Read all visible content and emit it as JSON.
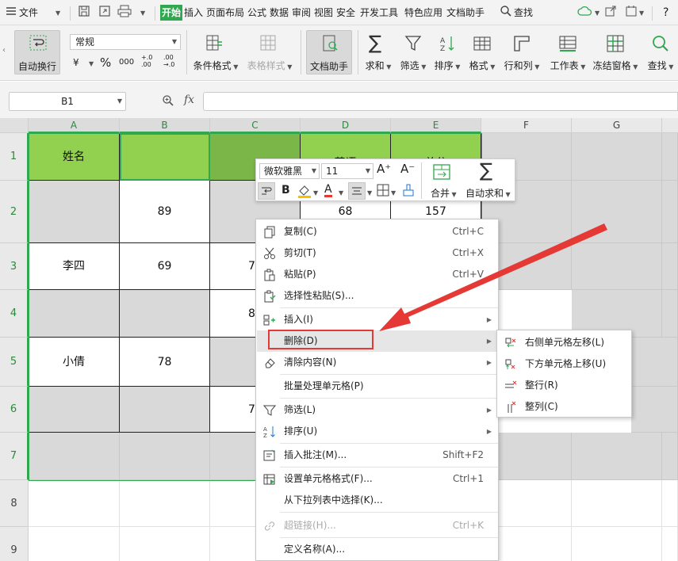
{
  "menubar": {
    "file_label": "文件",
    "tabs": [
      {
        "label": "开始",
        "active": true
      },
      {
        "label": "插入"
      },
      {
        "label": "页面布局"
      },
      {
        "label": "公式"
      },
      {
        "label": "数据"
      },
      {
        "label": "审阅"
      },
      {
        "label": "视图"
      },
      {
        "label": "安全"
      },
      {
        "label": "开发工具"
      },
      {
        "label": "特色应用"
      },
      {
        "label": "文档助手"
      }
    ],
    "search_label": "查找",
    "help_label": "?"
  },
  "ribbon": {
    "wrap_text": "自动换行",
    "number_format": "常规",
    "currency_symbol": "¥",
    "percent_symbol": "%",
    "comma_symbol": "000",
    "inc_decimal": "+.0 .00",
    "dec_decimal": ".00 →.0",
    "conditional_format": "条件格式",
    "table_style": "表格样式",
    "doc_assistant": "文档助手",
    "sum": "求和",
    "filter": "筛选",
    "sort": "排序",
    "format": "格式",
    "row_col": "行和列",
    "worksheet": "工作表",
    "freeze": "冻结窗格",
    "find": "查找"
  },
  "formula_bar": {
    "cell_ref": "B1",
    "fx": "fx",
    "formula": ""
  },
  "grid": {
    "columns": [
      "A",
      "B",
      "C",
      "D",
      "E",
      "F",
      "G"
    ],
    "rows": [
      "1",
      "2",
      "3",
      "4",
      "5",
      "6",
      "7",
      "8",
      "9"
    ],
    "cells": {
      "A1": "姓名",
      "D1": "英语",
      "E1": "总分",
      "B2": "89",
      "D2": "68",
      "E2": "157",
      "A3": "李四",
      "B3": "69",
      "C3": "7",
      "C4": "8",
      "A5": "小倩",
      "B5": "78",
      "C6": "7"
    }
  },
  "minibar": {
    "font_name": "微软雅黑",
    "font_size": "11",
    "grow_font": "A⁺",
    "shrink_font": "A⁻",
    "bold": "B",
    "merge": "合并",
    "autosum": "自动求和"
  },
  "context_menu": {
    "items": [
      {
        "label": "复制(C)",
        "shortcut": "Ctrl+C"
      },
      {
        "label": "剪切(T)",
        "shortcut": "Ctrl+X"
      },
      {
        "label": "粘贴(P)",
        "shortcut": "Ctrl+V"
      },
      {
        "label": "选择性粘贴(S)...",
        "shortcut": ""
      },
      {
        "label": "插入(I)",
        "shortcut": ""
      },
      {
        "label": "删除(D)",
        "shortcut": ""
      },
      {
        "label": "清除内容(N)",
        "shortcut": ""
      },
      {
        "label": "批量处理单元格(P)",
        "shortcut": ""
      },
      {
        "label": "筛选(L)",
        "shortcut": ""
      },
      {
        "label": "排序(U)",
        "shortcut": ""
      },
      {
        "label": "插入批注(M)...",
        "shortcut": "Shift+F2"
      },
      {
        "label": "设置单元格格式(F)...",
        "shortcut": "Ctrl+1"
      },
      {
        "label": "从下拉列表中选择(K)...",
        "shortcut": ""
      },
      {
        "label": "超链接(H)...",
        "shortcut": "Ctrl+K"
      },
      {
        "label": "定义名称(A)...",
        "shortcut": ""
      }
    ]
  },
  "submenu": {
    "items": [
      {
        "label": "右侧单元格左移(L)"
      },
      {
        "label": "下方单元格上移(U)"
      },
      {
        "label": "整行(R)"
      },
      {
        "label": "整列(C)"
      }
    ]
  },
  "colors": {
    "accent_green": "#2fa84f",
    "header_fill": "#92d050",
    "selected_fill": "#7ab648",
    "grey_fill": "#d9d9d9",
    "annotation_red": "#e53935"
  }
}
